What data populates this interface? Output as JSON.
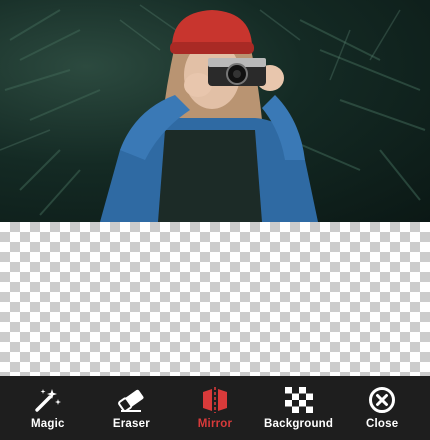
{
  "photo": {
    "description_icon": "woman-with-camera-photo"
  },
  "canvas": {
    "icon": "transparent-checkerboard"
  },
  "toolbar": {
    "items": [
      {
        "id": "magic",
        "label": "Magic",
        "icon": "magic-wand-icon",
        "active": false
      },
      {
        "id": "eraser",
        "label": "Eraser",
        "icon": "eraser-icon",
        "active": false
      },
      {
        "id": "mirror",
        "label": "Mirror",
        "icon": "mirror-icon",
        "active": true
      },
      {
        "id": "background",
        "label": "Background",
        "icon": "checkerboard-icon",
        "active": false
      },
      {
        "id": "close",
        "label": "Close",
        "icon": "close-circle-icon",
        "active": false
      }
    ]
  },
  "colors": {
    "toolbar_bg": "#1e1e1e",
    "label_default": "#ffffff",
    "label_active": "#d83a3a",
    "photo_dark_green": "#142a24"
  }
}
